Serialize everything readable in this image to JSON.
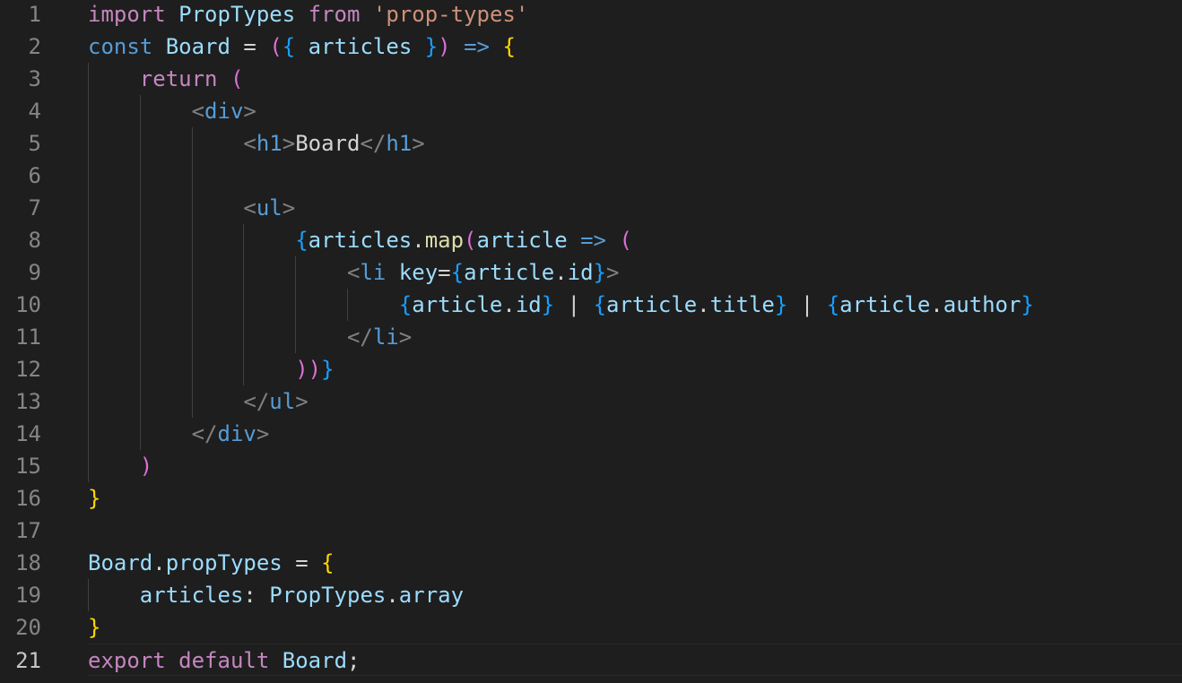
{
  "colors": {
    "background": "#1e1e1e",
    "line_number": "#858585",
    "line_number_active": "#c6c6c6",
    "keyword": "#c586c0",
    "declaration": "#569cd6",
    "variable": "#9cdcfe",
    "component": "#4ec9b0",
    "string": "#ce9178",
    "function": "#dcdcaa",
    "punctuation": "#d4d4d4",
    "tag_bracket": "#808080",
    "bracket_yellow": "#ffd700",
    "bracket_pink": "#da70d6",
    "bracket_blue": "#179fff"
  },
  "editor": {
    "active_line": 21,
    "lines": [
      {
        "n": "1",
        "tokens": [
          [
            "import",
            "keyword"
          ],
          [
            " ",
            "punctuation"
          ],
          [
            "PropTypes",
            "variable"
          ],
          [
            " ",
            "punctuation"
          ],
          [
            "from",
            "keyword"
          ],
          [
            " ",
            "punctuation"
          ],
          [
            "'prop-types'",
            "string"
          ]
        ]
      },
      {
        "n": "2",
        "tokens": [
          [
            "const",
            "declaration"
          ],
          [
            " ",
            "punctuation"
          ],
          [
            "Board",
            "variable"
          ],
          [
            " = ",
            "punctuation"
          ],
          [
            "(",
            "bracket_pink"
          ],
          [
            "{",
            "bracket_blue"
          ],
          [
            " articles ",
            "variable"
          ],
          [
            "}",
            "bracket_blue"
          ],
          [
            ")",
            "bracket_pink"
          ],
          [
            " ",
            "punctuation"
          ],
          [
            "=>",
            "declaration"
          ],
          [
            " ",
            "punctuation"
          ],
          [
            "{",
            "bracket_yellow"
          ]
        ]
      },
      {
        "n": "3",
        "tokens": [
          [
            "    ",
            "punctuation"
          ],
          [
            "return",
            "keyword"
          ],
          [
            " ",
            "punctuation"
          ],
          [
            "(",
            "bracket_pink"
          ]
        ]
      },
      {
        "n": "4",
        "tokens": [
          [
            "        ",
            "punctuation"
          ],
          [
            "<",
            "tag_bracket"
          ],
          [
            "div",
            "declaration"
          ],
          [
            ">",
            "tag_bracket"
          ]
        ]
      },
      {
        "n": "5",
        "tokens": [
          [
            "            ",
            "punctuation"
          ],
          [
            "<",
            "tag_bracket"
          ],
          [
            "h1",
            "declaration"
          ],
          [
            ">",
            "tag_bracket"
          ],
          [
            "Board",
            "punctuation"
          ],
          [
            "</",
            "tag_bracket"
          ],
          [
            "h1",
            "declaration"
          ],
          [
            ">",
            "tag_bracket"
          ]
        ]
      },
      {
        "n": "6",
        "tokens": []
      },
      {
        "n": "7",
        "tokens": [
          [
            "            ",
            "punctuation"
          ],
          [
            "<",
            "tag_bracket"
          ],
          [
            "ul",
            "declaration"
          ],
          [
            ">",
            "tag_bracket"
          ]
        ]
      },
      {
        "n": "8",
        "tokens": [
          [
            "                ",
            "punctuation"
          ],
          [
            "{",
            "bracket_blue"
          ],
          [
            "articles",
            "variable"
          ],
          [
            ".",
            "punctuation"
          ],
          [
            "map",
            "function"
          ],
          [
            "(",
            "bracket_pink"
          ],
          [
            "article",
            "variable"
          ],
          [
            " ",
            "punctuation"
          ],
          [
            "=>",
            "declaration"
          ],
          [
            " ",
            "punctuation"
          ],
          [
            "(",
            "bracket_pink"
          ]
        ]
      },
      {
        "n": "9",
        "tokens": [
          [
            "                    ",
            "punctuation"
          ],
          [
            "<",
            "tag_bracket"
          ],
          [
            "li",
            "declaration"
          ],
          [
            " ",
            "punctuation"
          ],
          [
            "key",
            "variable"
          ],
          [
            "=",
            "punctuation"
          ],
          [
            "{",
            "bracket_blue"
          ],
          [
            "article",
            "variable"
          ],
          [
            ".",
            "punctuation"
          ],
          [
            "id",
            "variable"
          ],
          [
            "}",
            "bracket_blue"
          ],
          [
            ">",
            "tag_bracket"
          ]
        ]
      },
      {
        "n": "10",
        "tokens": [
          [
            "                        ",
            "punctuation"
          ],
          [
            "{",
            "bracket_blue"
          ],
          [
            "article",
            "variable"
          ],
          [
            ".",
            "punctuation"
          ],
          [
            "id",
            "variable"
          ],
          [
            "}",
            "bracket_blue"
          ],
          [
            " | ",
            "punctuation"
          ],
          [
            "{",
            "bracket_blue"
          ],
          [
            "article",
            "variable"
          ],
          [
            ".",
            "punctuation"
          ],
          [
            "title",
            "variable"
          ],
          [
            "}",
            "bracket_blue"
          ],
          [
            " | ",
            "punctuation"
          ],
          [
            "{",
            "bracket_blue"
          ],
          [
            "article",
            "variable"
          ],
          [
            ".",
            "punctuation"
          ],
          [
            "author",
            "variable"
          ],
          [
            "}",
            "bracket_blue"
          ]
        ]
      },
      {
        "n": "11",
        "tokens": [
          [
            "                    ",
            "punctuation"
          ],
          [
            "</",
            "tag_bracket"
          ],
          [
            "li",
            "declaration"
          ],
          [
            ">",
            "tag_bracket"
          ]
        ]
      },
      {
        "n": "12",
        "tokens": [
          [
            "                ",
            "punctuation"
          ],
          [
            "))",
            "bracket_pink"
          ],
          [
            "}",
            "bracket_blue"
          ]
        ]
      },
      {
        "n": "13",
        "tokens": [
          [
            "            ",
            "punctuation"
          ],
          [
            "</",
            "tag_bracket"
          ],
          [
            "ul",
            "declaration"
          ],
          [
            ">",
            "tag_bracket"
          ]
        ]
      },
      {
        "n": "14",
        "tokens": [
          [
            "        ",
            "punctuation"
          ],
          [
            "</",
            "tag_bracket"
          ],
          [
            "div",
            "declaration"
          ],
          [
            ">",
            "tag_bracket"
          ]
        ]
      },
      {
        "n": "15",
        "tokens": [
          [
            "    ",
            "punctuation"
          ],
          [
            ")",
            "bracket_pink"
          ]
        ]
      },
      {
        "n": "16",
        "tokens": [
          [
            "}",
            "bracket_yellow"
          ]
        ]
      },
      {
        "n": "17",
        "tokens": []
      },
      {
        "n": "18",
        "tokens": [
          [
            "Board",
            "variable"
          ],
          [
            ".",
            "punctuation"
          ],
          [
            "propTypes",
            "variable"
          ],
          [
            " = ",
            "punctuation"
          ],
          [
            "{",
            "bracket_yellow"
          ]
        ]
      },
      {
        "n": "19",
        "tokens": [
          [
            "    ",
            "punctuation"
          ],
          [
            "articles",
            "variable"
          ],
          [
            ": ",
            "punctuation"
          ],
          [
            "PropTypes",
            "variable"
          ],
          [
            ".",
            "punctuation"
          ],
          [
            "array",
            "variable"
          ]
        ]
      },
      {
        "n": "20",
        "tokens": [
          [
            "}",
            "bracket_yellow"
          ]
        ]
      },
      {
        "n": "21",
        "tokens": [
          [
            "export",
            "keyword"
          ],
          [
            " ",
            "punctuation"
          ],
          [
            "default",
            "keyword"
          ],
          [
            " ",
            "punctuation"
          ],
          [
            "Board",
            "variable"
          ],
          [
            ";",
            "punctuation"
          ]
        ]
      }
    ]
  }
}
